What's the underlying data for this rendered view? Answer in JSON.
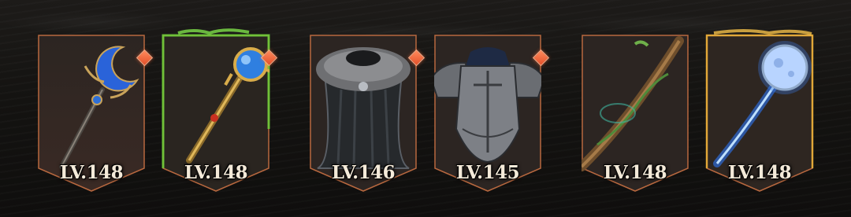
{
  "items": [
    {
      "name": "crescent-moon-staff",
      "level": "LV.148",
      "rarity": "rare",
      "has_badge": true
    },
    {
      "name": "golden-orb-scepter",
      "level": "LV.148",
      "rarity": "epic-green",
      "has_badge": true
    },
    {
      "name": "fur-cloak",
      "level": "LV.146",
      "rarity": "rare",
      "has_badge": true
    },
    {
      "name": "plate-chestpiece",
      "level": "LV.145",
      "rarity": "rare",
      "has_badge": true
    },
    {
      "name": "vine-wooden-staff",
      "level": "LV.148",
      "rarity": "rare",
      "has_badge": false
    },
    {
      "name": "full-moon-staff",
      "level": "LV.148",
      "rarity": "legendary",
      "has_badge": false
    }
  ],
  "colors": {
    "frame_border": "#b8683f",
    "card_fill": "#2a201c",
    "epic_glow": "#6cd33a",
    "legendary_glow": "#f0b63a",
    "badge": "#ef6a3c"
  }
}
